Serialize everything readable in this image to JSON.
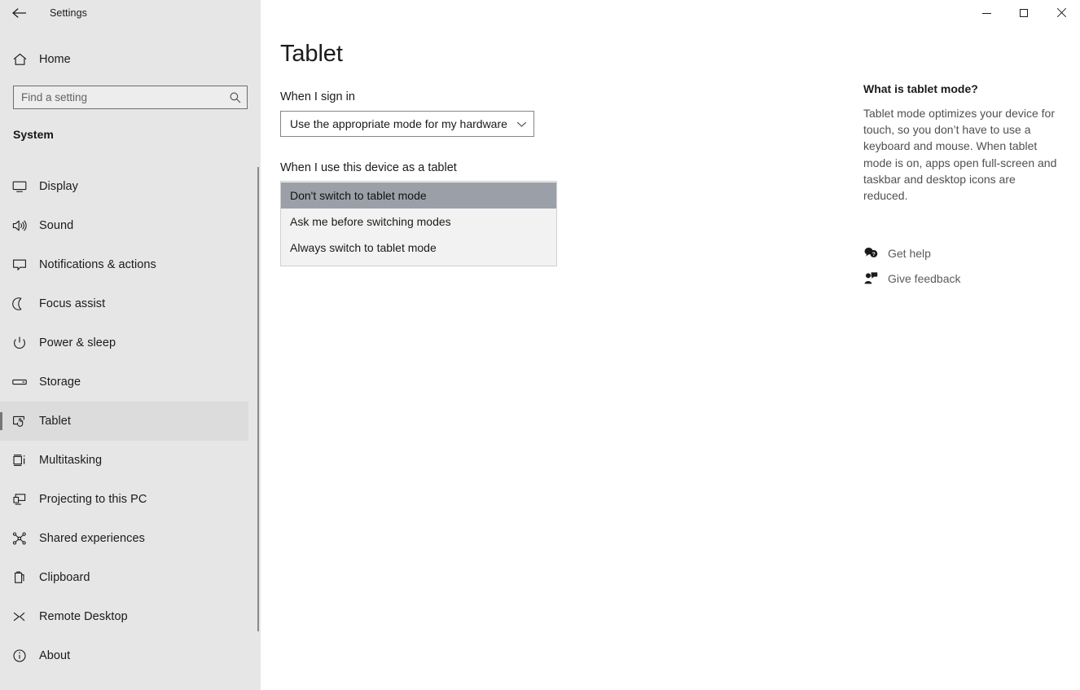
{
  "window": {
    "app_title": "Settings",
    "back_icon": "back-arrow-icon",
    "minimize_label": "Minimize",
    "maximize_label": "Maximize",
    "close_label": "Close"
  },
  "sidebar": {
    "home": {
      "label": "Home",
      "icon": "home-icon"
    },
    "search": {
      "value": "",
      "placeholder": "Find a setting",
      "icon": "search-icon"
    },
    "group_title": "System",
    "items": [
      {
        "label": "Display",
        "icon": "monitor-icon",
        "selected": false
      },
      {
        "label": "Sound",
        "icon": "speaker-icon",
        "selected": false
      },
      {
        "label": "Notifications & actions",
        "icon": "chat-bubble-icon",
        "selected": false
      },
      {
        "label": "Focus assist",
        "icon": "moon-icon",
        "selected": false
      },
      {
        "label": "Power & sleep",
        "icon": "power-icon",
        "selected": false
      },
      {
        "label": "Storage",
        "icon": "drive-icon",
        "selected": false
      },
      {
        "label": "Tablet",
        "icon": "tablet-touch-icon",
        "selected": true
      },
      {
        "label": "Multitasking",
        "icon": "multitask-icon",
        "selected": false
      },
      {
        "label": "Projecting to this PC",
        "icon": "project-screen-icon",
        "selected": false
      },
      {
        "label": "Shared experiences",
        "icon": "share-nodes-icon",
        "selected": false
      },
      {
        "label": "Clipboard",
        "icon": "clipboard-icon",
        "selected": false
      },
      {
        "label": "Remote Desktop",
        "icon": "remote-desktop-icon",
        "selected": false
      },
      {
        "label": "About",
        "icon": "info-circle-icon",
        "selected": false
      }
    ]
  },
  "main": {
    "page_title": "Tablet",
    "sign_in": {
      "label": "When I sign in",
      "selected_value": "Use the appropriate mode for my hardware",
      "chevron_icon": "chevron-down-icon"
    },
    "tablet_use": {
      "label": "When I use this device as a tablet",
      "options": [
        {
          "label": "Don't switch to tablet mode",
          "selected": true
        },
        {
          "label": "Ask me before switching modes",
          "selected": false
        },
        {
          "label": "Always switch to tablet mode",
          "selected": false
        }
      ]
    }
  },
  "help": {
    "heading": "What is tablet mode?",
    "body": "Tablet mode optimizes your device for touch, so you don’t have to use a keyboard and mouse. When tablet mode is on, apps open full-screen and taskbar and desktop icons are reduced.",
    "links": [
      {
        "label": "Get help",
        "icon": "get-help-icon"
      },
      {
        "label": "Give feedback",
        "icon": "give-feedback-icon"
      }
    ]
  },
  "colors": {
    "sidebar_bg": "#e6e6e6",
    "content_bg": "#ffffff",
    "selected_nav_bg": "#dcdcdc",
    "nav_accent": "#767676",
    "listbox_bg": "#f2f2f2",
    "listbox_selected_bg": "#9ba0a8",
    "text_primary": "#1b1b1b",
    "text_secondary": "#5b5b5b"
  }
}
